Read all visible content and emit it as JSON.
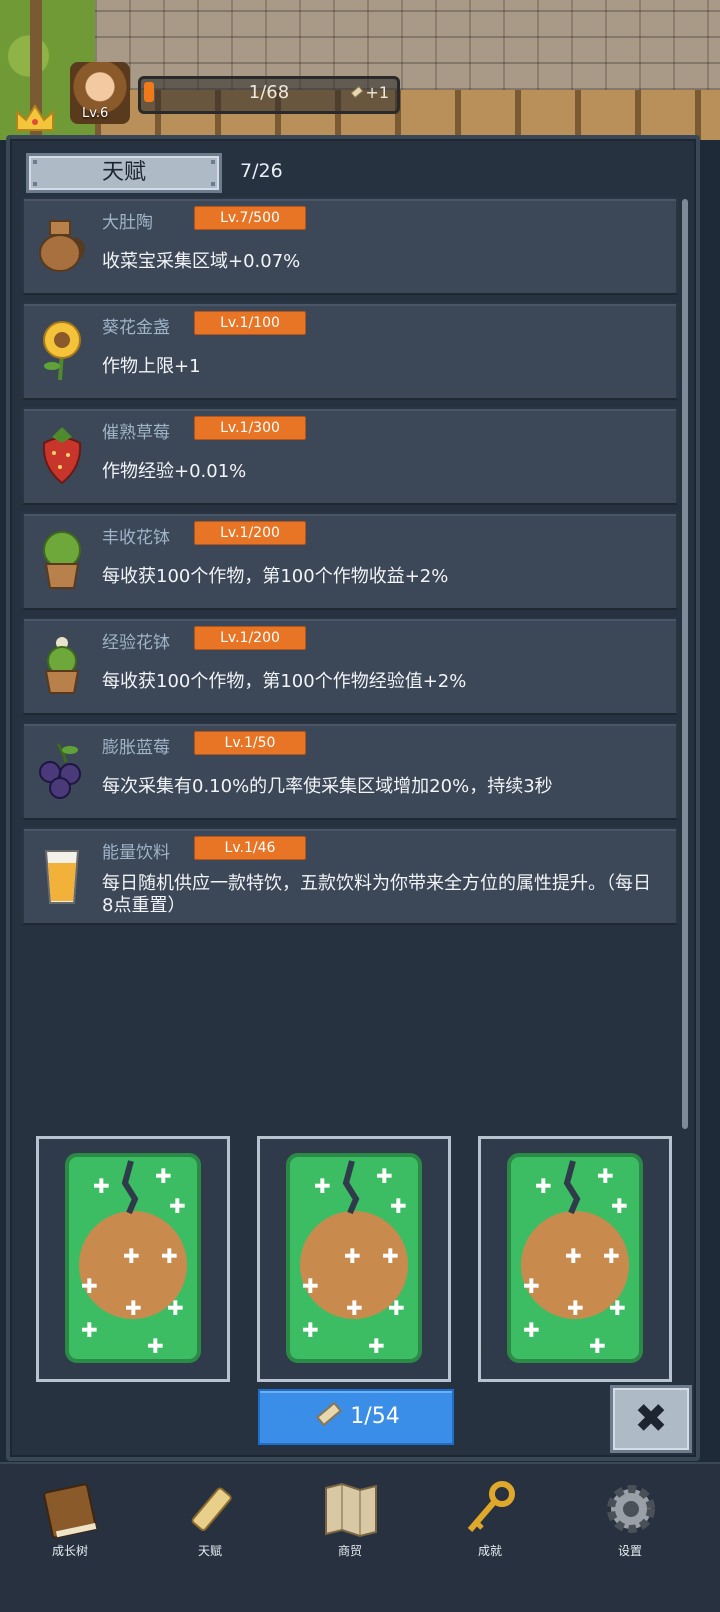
{
  "player": {
    "level_label": "Lv.6",
    "xp_text": "1/68",
    "xp_progress": 0.03,
    "xp_bonus": "+1"
  },
  "panel": {
    "title": "天赋",
    "count": "7/26"
  },
  "talents": [
    {
      "name": "大肚陶",
      "level": "Lv.7/500",
      "desc": "收菜宝采集区域+0.07%",
      "icon": "jar-icon"
    },
    {
      "name": "葵花金盏",
      "level": "Lv.1/100",
      "desc": "作物上限+1",
      "icon": "sunflower-icon"
    },
    {
      "name": "催熟草莓",
      "level": "Lv.1/300",
      "desc": "作物经验+0.01%",
      "icon": "strawberry-icon"
    },
    {
      "name": "丰收花钵",
      "level": "Lv.1/200",
      "desc": "每收获100个作物，第100个作物收益+2%",
      "icon": "flowerpot-icon"
    },
    {
      "name": "经验花钵",
      "level": "Lv.1/200",
      "desc": "每收获100个作物，第100个作物经验值+2%",
      "icon": "flowerpot-exp-icon"
    },
    {
      "name": "膨胀蓝莓",
      "level": "Lv.1/50",
      "desc": "每次采集有0.10%的几率使采集区域增加20%，持续3秒",
      "icon": "blueberry-icon"
    },
    {
      "name": "能量饮料",
      "level": "Lv.1/46",
      "desc": "每日随机供应一款特饮，五款饮料为你带来全方位的属性提升。（每日8点重置）",
      "icon": "drink-icon"
    }
  ],
  "draw_button": {
    "label": "1/54"
  },
  "nav": [
    {
      "label": "成长树",
      "icon": "book-icon"
    },
    {
      "label": "天赋",
      "icon": "scroll-icon"
    },
    {
      "label": "商贸",
      "icon": "map-icon"
    },
    {
      "label": "成就",
      "icon": "key-icon"
    },
    {
      "label": "设置",
      "icon": "gear-icon"
    }
  ],
  "colors": {
    "accent": "#e87525",
    "button_blue": "#3a8ee8",
    "card_green": "#3dbd63",
    "card_brown": "#c98a4e"
  }
}
